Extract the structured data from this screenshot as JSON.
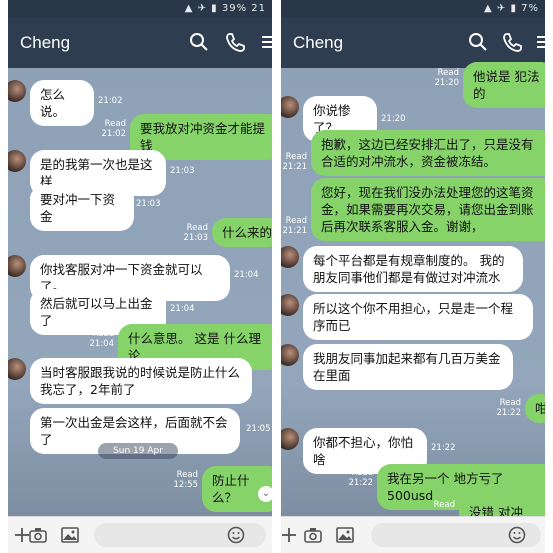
{
  "left": {
    "status_time": "21",
    "status_battery": "39%",
    "title": "Cheng",
    "messages": [
      {
        "text": "怎么说。",
        "time": "21:02"
      },
      {
        "text": "要我放对冲资金才能提钱",
        "read": "Read",
        "time": "21:02"
      },
      {
        "text": "是的我第一次也是这样",
        "time": "21:03"
      },
      {
        "text": "要对冲一下资金",
        "time": "21:03"
      },
      {
        "text": "什么来的",
        "read": "Read",
        "time": "21:03"
      },
      {
        "text": "你找客服对冲一下资金就可以了。",
        "time": "21:04"
      },
      {
        "text": "然后就可以马上出金了",
        "time": "21:04"
      },
      {
        "text": "什么意思。 这是 什么理论",
        "read": "Read",
        "time": "21:04"
      },
      {
        "text": "当时客服跟我说的时候说是防止什么我忘了，2年前了",
        "time": "21:05"
      },
      {
        "text": "第一次出金是会这样，后面就不会了",
        "time": "21:05"
      },
      {
        "text": "防止什么？",
        "read": "Read",
        "time": "12:55"
      }
    ],
    "date_label": "Sun 19 Apr"
  },
  "right": {
    "status_battery": "7%",
    "title": "Cheng",
    "messages": [
      {
        "text": "他说是 犯法的",
        "read": "Read",
        "time": "21:20"
      },
      {
        "text": "你说惨了？",
        "time": "21:20"
      },
      {
        "text": "抱歉，这边已经安排汇出了，只是没有合适的对冲流水，资金被冻结。",
        "read": "Read",
        "time": "21:21"
      },
      {
        "text": "您好，现在我们没办法处理您的这笔资金，如果需要再次交易，请您出金到账后再次联系客服入金。谢谢，",
        "read": "Read",
        "time": "21:21"
      },
      {
        "text": "每个平台都是有规章制度的。 我的朋友同事他们都是有做过对冲流水",
        "time": ""
      },
      {
        "text": "所以这个你不用担心，只是走一个程序而已",
        "time": ""
      },
      {
        "text": "我朋友同事加起来都有几百万美金在里面",
        "time": ""
      },
      {
        "text": "咁",
        "read": "Read",
        "time": "21:22"
      },
      {
        "text": "你都不担心，你怕啥",
        "time": "21:22"
      },
      {
        "text": "我在另一个 地方亏了500usd",
        "read": "Read",
        "time": "21:22"
      },
      {
        "text": "没错 对冲",
        "read": "Read",
        "time": ""
      }
    ]
  },
  "colors": {
    "header": "#2f3d51",
    "outgoing": "#86d36a",
    "incoming": "#ffffff",
    "chat_bg": "#8fa2b8"
  },
  "icons": [
    "search-icon",
    "phone-icon",
    "menu-icon",
    "add-icon",
    "camera-icon",
    "image-icon",
    "emoji-icon",
    "chevron-down-icon"
  ]
}
